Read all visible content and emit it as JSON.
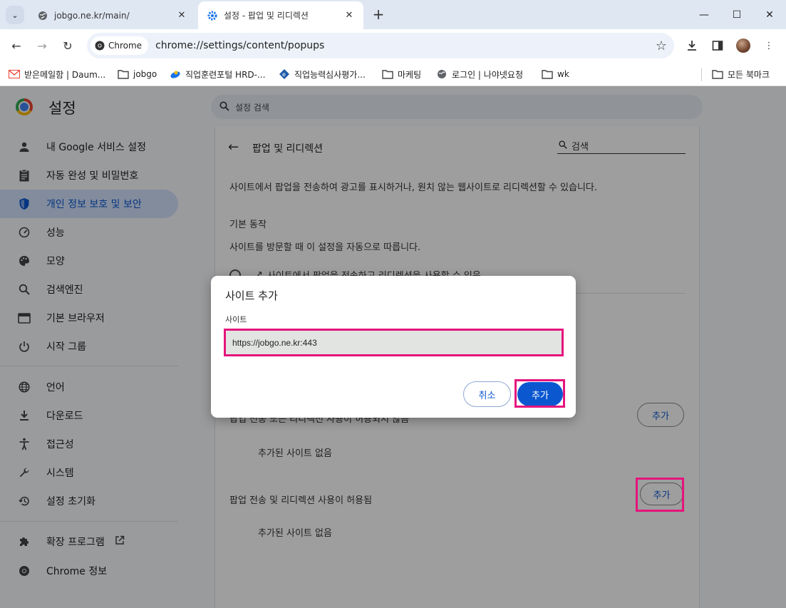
{
  "browser": {
    "tabs": [
      {
        "title": "jobgo.ne.kr/main/",
        "active": false
      },
      {
        "title": "설정 - 팝업 및 리디렉션",
        "active": true
      }
    ],
    "new_tab": "+",
    "url_chip": "Chrome",
    "url": "chrome://settings/content/popups",
    "window_controls": {
      "minimize": "—",
      "maximize": "☐",
      "close": "✕"
    }
  },
  "bookmarks": {
    "items": [
      {
        "label": "받은메일함 | Daum...",
        "icon": "mail-icon"
      },
      {
        "label": "jobgo",
        "icon": "folder-icon"
      },
      {
        "label": "직업훈련포털 HRD-...",
        "icon": "site-icon"
      },
      {
        "label": "직업능력심사평가...",
        "icon": "site-icon"
      },
      {
        "label": "마케팅",
        "icon": "folder-icon"
      },
      {
        "label": "로그인 | 나야넷요청",
        "icon": "globe-icon"
      },
      {
        "label": "wk",
        "icon": "folder-icon"
      }
    ],
    "all_bookmarks": "모든 북마크"
  },
  "settings": {
    "title": "설정",
    "search_placeholder": "설정 검색",
    "nav": [
      {
        "label": "내 Google 서비스 설정",
        "icon": "person-icon"
      },
      {
        "label": "자동 완성 및 비밀번호",
        "icon": "clipboard-icon"
      },
      {
        "label": "개인 정보 보호 및 보안",
        "icon": "shield-icon",
        "active": true
      },
      {
        "label": "성능",
        "icon": "speedometer-icon"
      },
      {
        "label": "모양",
        "icon": "palette-icon"
      },
      {
        "label": "검색엔진",
        "icon": "search-icon"
      },
      {
        "label": "기본 브라우저",
        "icon": "browser-icon"
      },
      {
        "label": "시작 그룹",
        "icon": "power-icon"
      },
      {
        "label": "언어",
        "icon": "globe-icon"
      },
      {
        "label": "다운로드",
        "icon": "download-icon"
      },
      {
        "label": "접근성",
        "icon": "accessibility-icon"
      },
      {
        "label": "시스템",
        "icon": "wrench-icon"
      },
      {
        "label": "설정 초기화",
        "icon": "history-icon"
      },
      {
        "label": "확장 프로그램",
        "icon": "puzzle-icon"
      },
      {
        "label": "Chrome 정보",
        "icon": "chrome-icon"
      }
    ],
    "content": {
      "page_title": "팝업 및 리디렉션",
      "search_placeholder": "검색",
      "description": "사이트에서 팝업을 전송하여 광고를 표시하거나, 원치 않는 웹사이트로 리디렉션할 수 있습니다.",
      "default_behavior": "기본 동작",
      "default_sub": "사이트를 방문할 때 이 설정을 자동으로 따릅니다.",
      "radio_allow": "사이트에서 팝업을 전송하고 리디렉션을 사용할 수 있음",
      "blocked_section": "팝업 전송 또는 리디렉션 사용이 허용되지 않음",
      "allowed_section": "팝업 전송 및 리디렉션 사용이 허용됨",
      "no_sites": "추가된 사이트 없음",
      "add_label": "추가"
    }
  },
  "dialog": {
    "title": "사이트 추가",
    "field_label": "사이트",
    "field_value": "https://jobgo.ne.kr:443",
    "cancel": "취소",
    "add": "추가"
  },
  "colors": {
    "accent": "#0b57d0",
    "highlight": "#e5147d",
    "active_nav_bg": "#d3e3fd"
  }
}
